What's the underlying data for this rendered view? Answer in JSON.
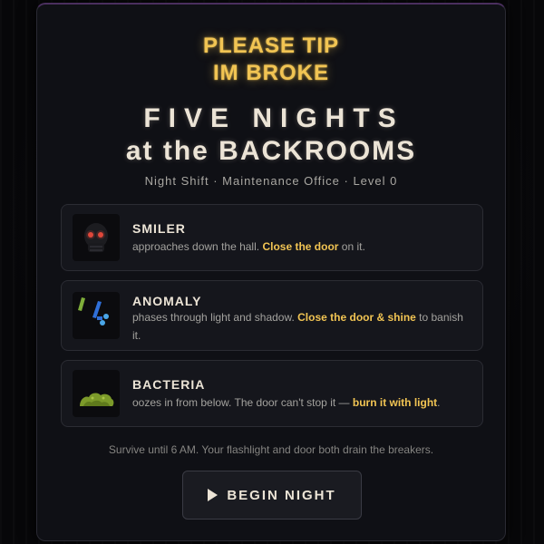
{
  "banner": {
    "line1": "PLEASE TIP",
    "line2": "IM BROKE"
  },
  "title": {
    "line1": "FIVE NIGHTS",
    "line2": "at the BACKROOMS"
  },
  "subtitle": "Night Shift · Maintenance Office · Level 0",
  "entities": [
    {
      "name": "SMILER",
      "icon": "smiler-icon",
      "desc_before": "approaches down the hall. ",
      "desc_highlight": "Close the door",
      "desc_after": " on it."
    },
    {
      "name": "ANOMALY",
      "icon": "anomaly-icon",
      "desc_before": "phases through light and shadow. ",
      "desc_highlight": "Close the door & shine",
      "desc_after": " to banish it."
    },
    {
      "name": "BACTERIA",
      "icon": "bacteria-icon",
      "desc_before": "oozes in from below. The door can't stop it — ",
      "desc_highlight": "burn it with light",
      "desc_after": "."
    }
  ],
  "footer": "Survive until 6 AM. Your flashlight and door both drain the breakers.",
  "begin_button": {
    "label": "BEGIN NIGHT",
    "icon": "play-icon"
  },
  "colors": {
    "accent": "#f1c453",
    "title": "#ece4d6",
    "panel": "#0f1015",
    "card": "#15161c"
  }
}
